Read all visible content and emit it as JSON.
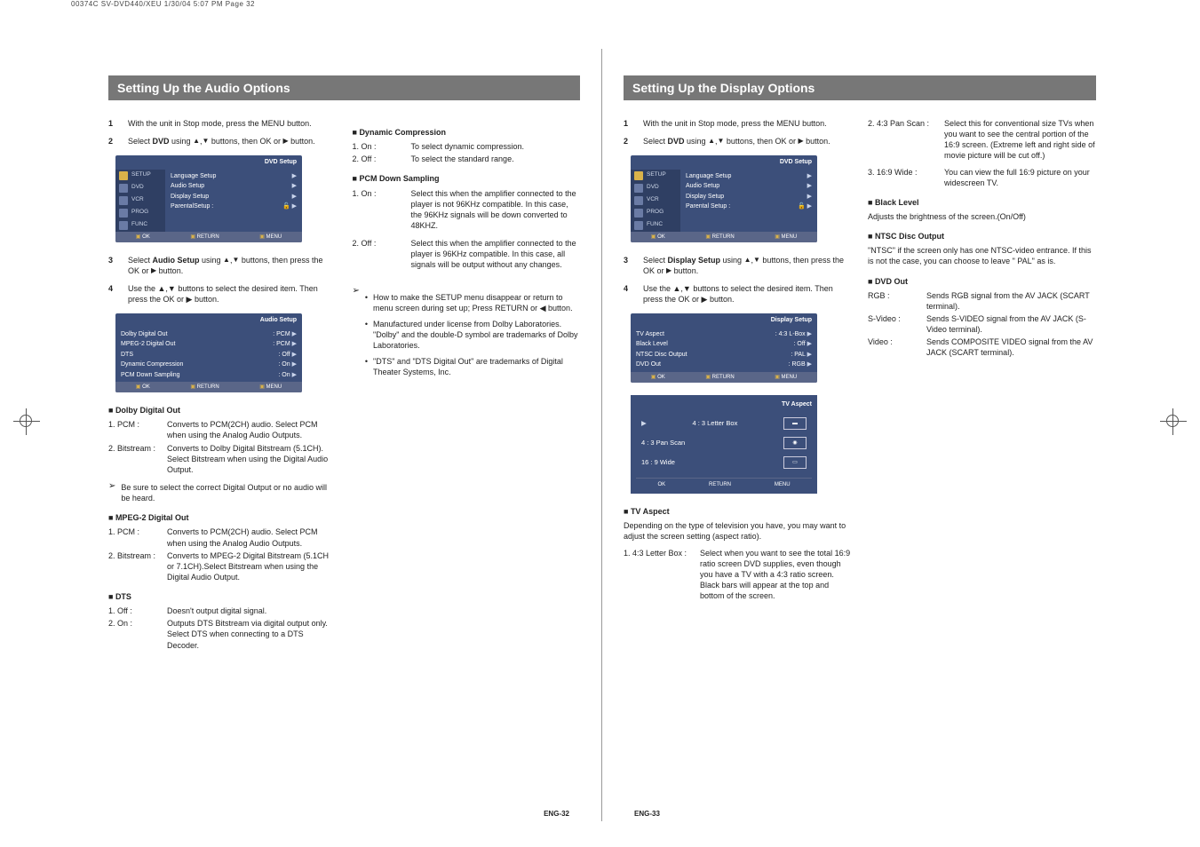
{
  "header_line": "00374C SV-DVD440/XEU  1/30/04 5:07 PM  Page 32",
  "left": {
    "section_title": "Setting Up the Audio Options",
    "steps": [
      "With the unit in Stop mode, press the MENU button.",
      "Select DVD using ▲,▼ buttons, then OK or ▶ button.",
      "Select Audio Setup using ▲,▼ buttons, then press the OK or ▶ button.",
      "Use the ▲,▼ buttons to select the desired item. Then press the OK or ▶ button."
    ],
    "screenshot1": {
      "title": "DVD Setup",
      "sidebar": [
        "SETUP",
        "DVD",
        "VCR",
        "PROG",
        "FUNC"
      ],
      "main": [
        {
          "label": "Language Setup",
          "val": "▶"
        },
        {
          "label": "Audio Setup",
          "val": "▶"
        },
        {
          "label": "Display Setup",
          "val": "▶"
        },
        {
          "label": "ParentalSetup :",
          "val": "▶",
          "icon": "🔓"
        }
      ],
      "footer": [
        "OK",
        "RETURN",
        "MENU"
      ]
    },
    "screenshot2": {
      "title": "Audio Setup",
      "main": [
        {
          "label": "Dolby Digital Out",
          "val": ": PCM"
        },
        {
          "label": "MPEG-2 Digital Out",
          "val": ": PCM"
        },
        {
          "label": "DTS",
          "val": ": Off"
        },
        {
          "label": "Dynamic Compression",
          "val": ": On"
        },
        {
          "label": "PCM Down Sampling",
          "val": ": On"
        }
      ],
      "footer": [
        "OK",
        "RETURN",
        "MENU"
      ]
    },
    "dolby": {
      "head": "Dolby Digital Out",
      "items": [
        {
          "k": "1. PCM :",
          "v": "Converts to PCM(2CH) audio. Select PCM when using the Analog Audio Outputs."
        },
        {
          "k": "2. Bitstream :",
          "v": "Converts to Dolby Digital Bitstream (5.1CH). Select Bitstream when using the Digital Audio Output."
        }
      ],
      "note": "Be sure to select the correct Digital Output or no audio will be heard."
    },
    "mpeg": {
      "head": "MPEG-2 Digital Out",
      "items": [
        {
          "k": "1. PCM :",
          "v": "Converts to PCM(2CH) audio. Select PCM when using the Analog Audio Outputs."
        },
        {
          "k": "2. Bitstream :",
          "v": "Converts to MPEG-2 Digital Bitstream (5.1CH or 7.1CH).Select Bitstream when using the Digital Audio Output."
        }
      ]
    },
    "dts": {
      "head": "DTS",
      "items": [
        {
          "k": "1. Off :",
          "v": "Doesn't output digital signal."
        },
        {
          "k": "2. On :",
          "v": "Outputs DTS Bitstream via digital output only. Select DTS when connecting to a DTS Decoder."
        }
      ]
    },
    "dyn": {
      "head": "Dynamic Compression",
      "items": [
        {
          "k": "1. On :",
          "v": "To select dynamic compression."
        },
        {
          "k": "2. Off :",
          "v": "To select the standard range."
        }
      ]
    },
    "pcm": {
      "head": "PCM Down Sampling",
      "items": [
        {
          "k": "1. On :",
          "v": "Select this when the amplifier connected to the player is not 96KHz compatible. In this case, the 96KHz signals will be down converted to 48KHZ."
        },
        {
          "k": "2. Off :",
          "v": "Select this when the amplifier connected to the player is 96KHz compatible. In this case, all signals will be output without any changes."
        }
      ]
    },
    "notes": [
      "How to make the SETUP menu disappear or return to menu screen during set up; Press RETURN or ◀ button.",
      "Manufactured under license from Dolby Laboratories. \"Dolby\" and the double-D symbol are trademarks of Dolby Laboratories.",
      "\"DTS\" and \"DTS Digital Out\" are trademarks of Digital Theater Systems, Inc."
    ],
    "page_num": "ENG-32"
  },
  "right": {
    "section_title": "Setting Up the Display Options",
    "steps": [
      "With the unit in Stop mode, press the MENU button.",
      "Select DVD using ▲,▼ buttons, then OK or ▶ button.",
      "Select Display Setup using ▲,▼ buttons, then press the OK or ▶ button.",
      "Use the ▲,▼ buttons to select the desired item. Then press the OK or ▶ button."
    ],
    "screenshot1": {
      "title": "DVD Setup",
      "sidebar": [
        "SETUP",
        "DVD",
        "VCR",
        "PROG",
        "FUNC"
      ],
      "main": [
        {
          "label": "Language Setup",
          "val": "▶"
        },
        {
          "label": "Audio Setup",
          "val": "▶"
        },
        {
          "label": "Display Setup",
          "val": "▶"
        },
        {
          "label": "Parental Setup :",
          "val": "▶",
          "icon": "🔓"
        }
      ],
      "footer": [
        "OK",
        "RETURN",
        "MENU"
      ]
    },
    "screenshot2": {
      "title": "Display Setup",
      "main": [
        {
          "label": "TV Aspect",
          "val": ": 4:3 L-Box"
        },
        {
          "label": "Black Level",
          "val": ": Off"
        },
        {
          "label": "NTSC Disc Output",
          "val": ": PAL"
        },
        {
          "label": "DVD Out",
          "val": ": RGB"
        }
      ],
      "footer": [
        "OK",
        "RETURN",
        "MENU"
      ]
    },
    "tvaspect_menu": {
      "title": "TV Aspect",
      "options": [
        "4 : 3 Letter Box",
        "4 : 3 Pan Scan",
        "16 : 9 Wide"
      ],
      "footer": [
        "OK",
        "RETURN",
        "MENU"
      ]
    },
    "tvaspect": {
      "head": "TV Aspect",
      "intro": "Depending on the type of television you have, you may want to adjust the screen setting (aspect ratio).",
      "items": [
        {
          "k": "1. 4:3 Letter Box :",
          "v": "Select when you want to see the total 16:9 ratio screen DVD supplies, even though you have a TV with a 4:3 ratio screen. Black bars will appear at the top and bottom of the screen."
        },
        {
          "k": "2. 4:3 Pan Scan :",
          "v": "Select this for conventional size TVs when you want to see the central portion of the 16:9 screen. (Extreme left and right side of movie picture will be cut off.)"
        },
        {
          "k": "3. 16:9 Wide :",
          "v": "You can view the full 16:9 picture on your widescreen TV."
        }
      ]
    },
    "black": {
      "head": "Black Level",
      "body": "Adjusts the brightness of the screen.(On/Off)"
    },
    "ntsc": {
      "head": "NTSC Disc Output",
      "body": "\"NTSC\" if the screen only has one NTSC-video entrance. If this is not the case, you can choose to leave \" PAL\" as is."
    },
    "dvdout": {
      "head": "DVD Out",
      "items": [
        {
          "k": "RGB :",
          "v": "Sends RGB signal from the AV JACK (SCART terminal)."
        },
        {
          "k": "S-Video :",
          "v": "Sends S-VIDEO signal from the AV JACK (S-Video terminal)."
        },
        {
          "k": "Video :",
          "v": "Sends COMPOSITE VIDEO signal from the AV JACK (SCART terminal)."
        }
      ]
    },
    "page_num": "ENG-33"
  }
}
